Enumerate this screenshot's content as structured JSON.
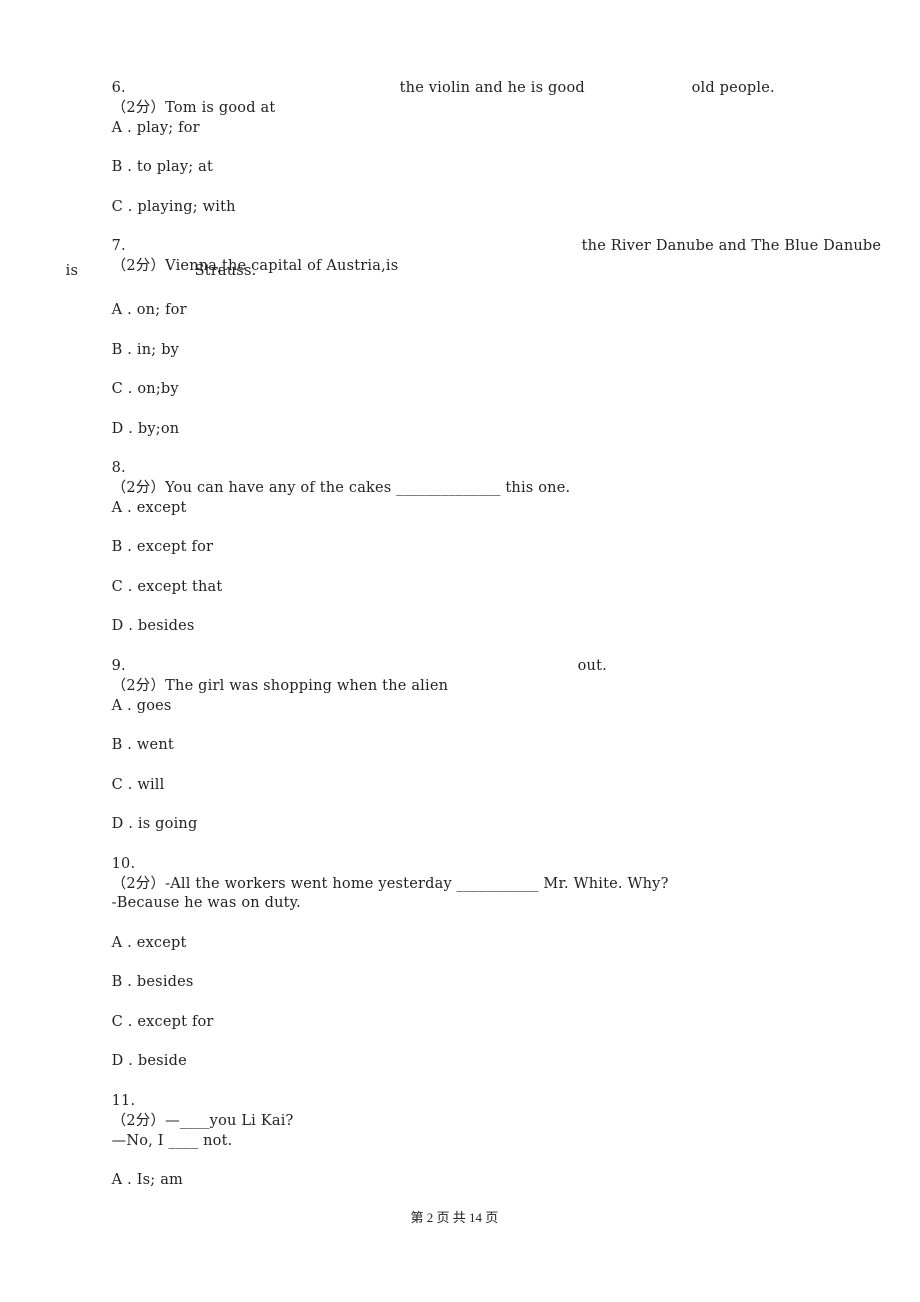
{
  "questions": [
    {
      "number": "6.",
      "score": "（2分）",
      "stem_parts": [
        "Tom is good at",
        "the violin and he is good",
        "old people."
      ],
      "options": [
        {
          "letter": "A .",
          "text": "play; for"
        },
        {
          "letter": "B .",
          "text": "to play; at"
        },
        {
          "letter": "C .",
          "text": "playing; with"
        }
      ]
    },
    {
      "number": "7.",
      "score": "（2分）",
      "stem_parts": [
        "Vienna,the capital of Austria,is",
        "the River Danube and The Blue Danube",
        "is",
        "Strauss."
      ],
      "options": [
        {
          "letter": "A .",
          "text": "on; for"
        },
        {
          "letter": "B .",
          "text": "in; by"
        },
        {
          "letter": "C .",
          "text": "on;by"
        },
        {
          "letter": "D .",
          "text": "by;on"
        }
      ]
    },
    {
      "number": "8.",
      "score": "（2分）",
      "stem_parts": [
        "You can have any of the cakes",
        "______________",
        "this one."
      ],
      "options": [
        {
          "letter": "A .",
          "text": "except"
        },
        {
          "letter": "B .",
          "text": "except for"
        },
        {
          "letter": "C .",
          "text": "except that"
        },
        {
          "letter": "D .",
          "text": "besides"
        }
      ]
    },
    {
      "number": "9.",
      "score": "（2分）",
      "stem_parts": [
        "The girl was shopping when the alien",
        "out."
      ],
      "options": [
        {
          "letter": "A .",
          "text": "goes"
        },
        {
          "letter": "B .",
          "text": "went"
        },
        {
          "letter": "C .",
          "text": "will"
        },
        {
          "letter": "D .",
          "text": "is going"
        }
      ]
    },
    {
      "number": "10.",
      "score": "（2分）",
      "stem_parts": [
        "-All the workers went home yesterday",
        "___________",
        "Mr. White. Why?"
      ],
      "stem_line2": "-Because he was on duty.",
      "options": [
        {
          "letter": "A .",
          "text": "except"
        },
        {
          "letter": "B .",
          "text": "besides"
        },
        {
          "letter": "C .",
          "text": "except for"
        },
        {
          "letter": "D .",
          "text": "beside"
        }
      ]
    },
    {
      "number": "11.",
      "score": "（2分）",
      "stem_parts": [
        "—",
        "____",
        "you Li Kai?"
      ],
      "stem_line2": "—No, I ____ not.",
      "options": [
        {
          "letter": "A .",
          "text": "Is; am"
        }
      ]
    }
  ],
  "footer": {
    "page_text": "第 2 页 共 14 页"
  }
}
